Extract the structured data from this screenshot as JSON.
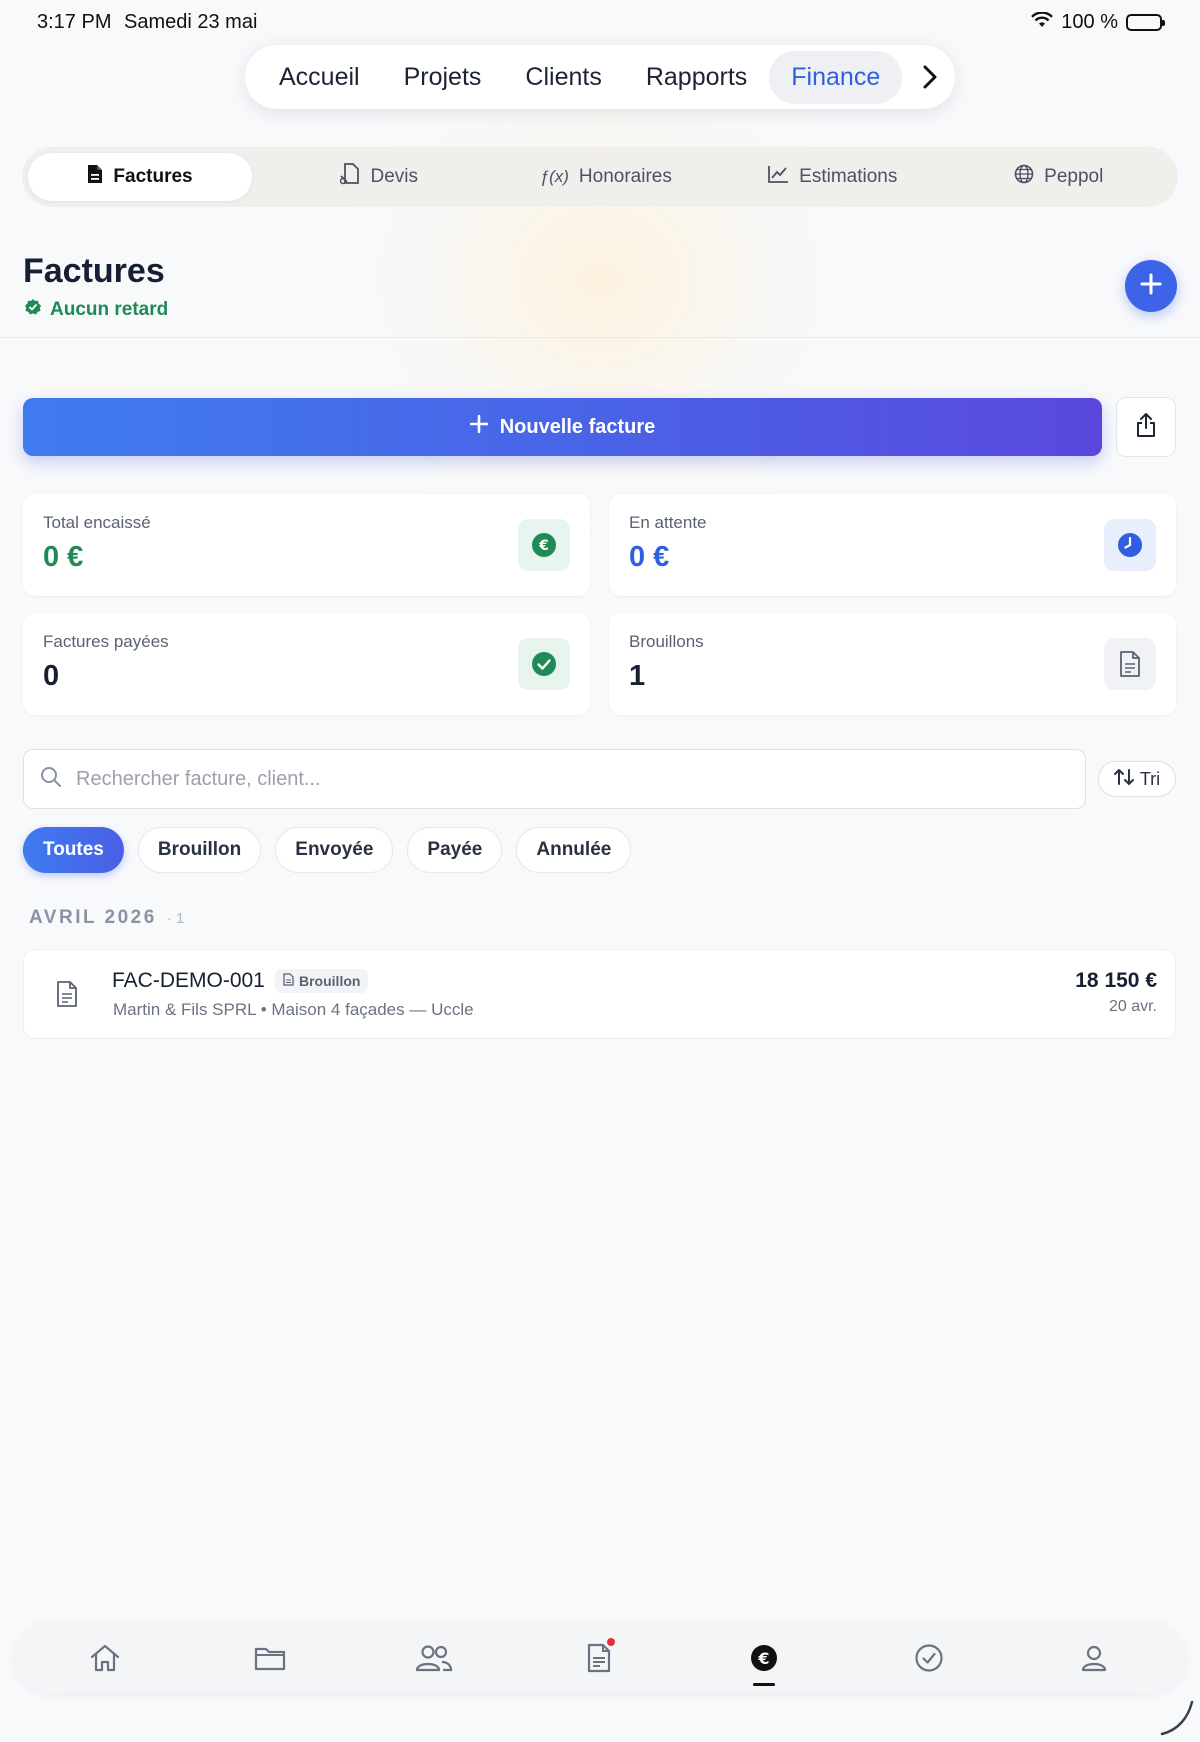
{
  "status_bar": {
    "time": "3:17 PM",
    "date": "Samedi 23 mai",
    "battery": "100 %"
  },
  "top_nav": {
    "items": [
      {
        "label": "Accueil"
      },
      {
        "label": "Projets"
      },
      {
        "label": "Clients"
      },
      {
        "label": "Rapports"
      },
      {
        "label": "Finance",
        "active": true
      }
    ]
  },
  "sub_tabs": [
    {
      "label": "Factures",
      "icon": "document-icon",
      "active": true
    },
    {
      "label": "Devis",
      "icon": "quote-doc-icon"
    },
    {
      "label": "Honoraires",
      "icon": "function-icon",
      "glyph": "ƒ(x)"
    },
    {
      "label": "Estimations",
      "icon": "chart-icon"
    },
    {
      "label": "Peppol",
      "icon": "globe-icon"
    }
  ],
  "header": {
    "title": "Factures",
    "status": "Aucun retard"
  },
  "actions": {
    "new_invoice": "Nouvelle facture"
  },
  "stats": [
    {
      "label": "Total encaissé",
      "value": "0 €",
      "color": "#1f8a55",
      "icon": "euro-icon"
    },
    {
      "label": "En attente",
      "value": "0 €",
      "color": "#2f5fe0",
      "icon": "clock-icon"
    },
    {
      "label": "Factures payées",
      "value": "0",
      "color": "#172033",
      "icon": "check-icon"
    },
    {
      "label": "Brouillons",
      "value": "1",
      "color": "#172033",
      "icon": "draft-doc-icon"
    }
  ],
  "search": {
    "placeholder": "Rechercher facture, client..."
  },
  "sort": {
    "label": "Tri"
  },
  "filters": [
    {
      "label": "Toutes",
      "active": true
    },
    {
      "label": "Brouillon"
    },
    {
      "label": "Envoyée"
    },
    {
      "label": "Payée"
    },
    {
      "label": "Annulée"
    }
  ],
  "groups": [
    {
      "title": "AVRIL 2026",
      "count": "· 1",
      "invoices": [
        {
          "number": "FAC-DEMO-001",
          "status": "Brouillon",
          "client": "Martin & Fils SPRL",
          "project": "Maison 4 façades — Uccle",
          "amount": "18 150 €",
          "date": "20 avr."
        }
      ]
    }
  ],
  "bottom_tabs": [
    {
      "icon": "home-icon"
    },
    {
      "icon": "folder-icon"
    },
    {
      "icon": "users-icon"
    },
    {
      "icon": "document-icon",
      "notification": true
    },
    {
      "icon": "euro-icon",
      "active": true
    },
    {
      "icon": "check-circle-icon"
    },
    {
      "icon": "user-icon"
    }
  ],
  "colors": {
    "accent": "#3d63e6",
    "success": "#1f8a55",
    "notification": "#e0323c"
  }
}
